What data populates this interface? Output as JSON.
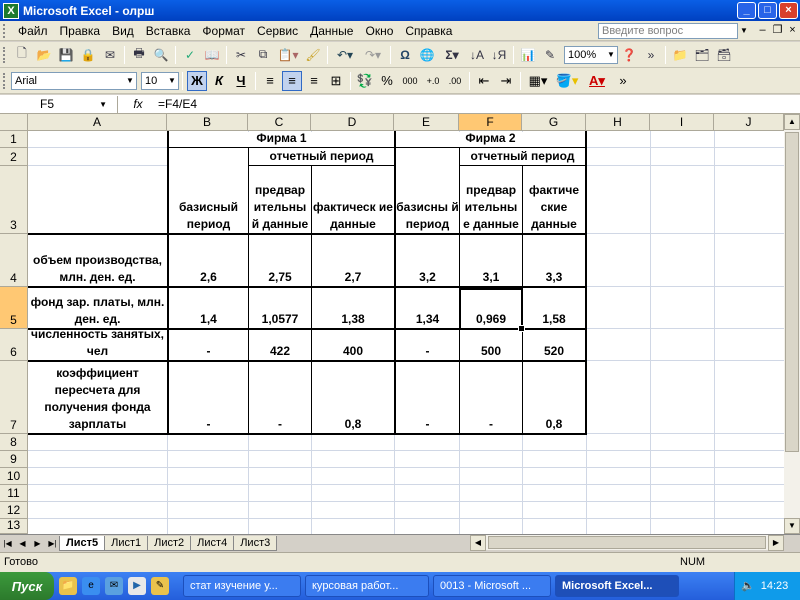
{
  "window": {
    "title": "Microsoft Excel - олрш",
    "app_icon": "X",
    "min": "_",
    "max": "□",
    "close": "×"
  },
  "menu": {
    "items": [
      "Файл",
      "Правка",
      "Вид",
      "Вставка",
      "Формат",
      "Сервис",
      "Данные",
      "Окно",
      "Справка"
    ],
    "ask_placeholder": "Введите вопрос"
  },
  "toolbar": {
    "zoom": "100%"
  },
  "format": {
    "font": "Arial",
    "size": "10",
    "bold": "Ж",
    "italic": "К",
    "underline": "Ч",
    "percent": "%",
    "thousands": "000"
  },
  "formula_bar": {
    "name_box": "F5",
    "fx": "fx",
    "formula": "=F4/E4"
  },
  "columns": [
    "A",
    "B",
    "C",
    "D",
    "E",
    "F",
    "G",
    "H",
    "I",
    "J"
  ],
  "rows": [
    "1",
    "2",
    "3",
    "4",
    "5",
    "6",
    "7",
    "8",
    "9",
    "10",
    "11",
    "12",
    "13"
  ],
  "table": {
    "firm1": "Фирма 1",
    "firm2": "Фирма 2",
    "report_period1": "отчетный период",
    "report_period2": "отчетный период",
    "h_b": "базисный период",
    "h_c": "предвар ительны й данные",
    "h_d": "фактическ ие данные",
    "h_e": "базисны й период",
    "h_f": "предвар ительны е данные",
    "h_g": "фактиче ские данные",
    "r4": {
      "label": "объем производства, млн. ден. ед.",
      "b": "2,6",
      "c": "2,75",
      "d": "2,7",
      "e": "3,2",
      "f": "3,1",
      "g": "3,3"
    },
    "r5": {
      "label": "фонд зар. платы, млн. ден. ед.",
      "b": "1,4",
      "c": "1,0577",
      "d": "1,38",
      "e": "1,34",
      "f": "0,969",
      "g": "1,58"
    },
    "r6": {
      "label": "численность занятых, чел",
      "b": "-",
      "c": "422",
      "d": "400",
      "e": "-",
      "f": "500",
      "g": "520"
    },
    "r7": {
      "label": "коэффициент пересчета для получения фонда зарплаты",
      "b": "-",
      "c": "-",
      "d": "0,8",
      "e": "-",
      "f": "-",
      "g": "0,8"
    }
  },
  "sheets": [
    "Лист5",
    "Лист1",
    "Лист2",
    "Лист4",
    "Лист3"
  ],
  "status": {
    "ready": "Готово",
    "num": "NUM"
  },
  "taskbar": {
    "start": "Пуск",
    "items": [
      "стат изучение у...",
      "курсовая работ...",
      "0013 - Microsoft ...",
      "Microsoft Excel..."
    ],
    "clock": "14:23"
  }
}
